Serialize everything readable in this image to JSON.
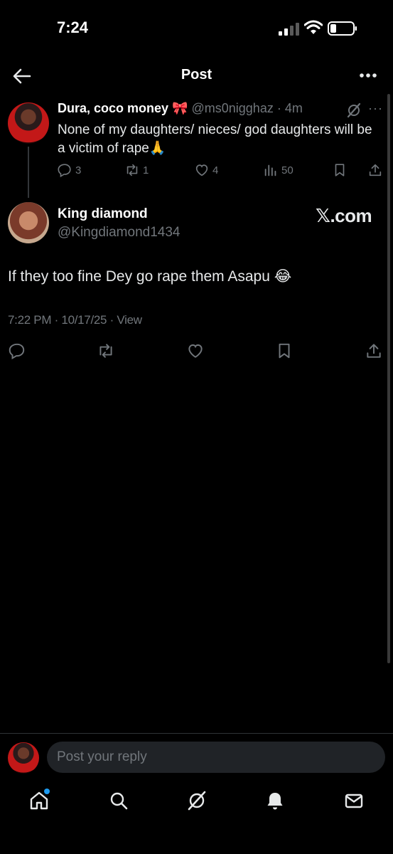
{
  "status": {
    "time": "7:24"
  },
  "nav": {
    "title": "Post"
  },
  "parent": {
    "name": "Dura, coco money",
    "emoji": "🎀",
    "handle_time": "@ms0nigghaz · 4m",
    "more": "···",
    "text": "None of my daughters/ nieces/ god daughters will be a victim of rape🙏",
    "replies": "3",
    "reposts": "1",
    "likes": "4",
    "views": "50"
  },
  "main": {
    "name": "King diamond",
    "handle": "@Kingdiamond1434",
    "watermark": "𝕏.com",
    "text": "If they too fine Dey go rape them Asapu 😂",
    "meta": "7:22 PM · 10/17/25 · View"
  },
  "reply": {
    "placeholder": "Post your reply"
  },
  "icons": {
    "back": "arrow-left-icon",
    "more": "more-icon",
    "grok": "grok-icon",
    "reply": "comment-icon",
    "repost": "repost-icon",
    "like": "heart-icon",
    "views": "views-icon",
    "bookmark": "bookmark-icon",
    "share": "share-icon",
    "home": "home-icon",
    "search": "search-icon",
    "notifications": "bell-icon",
    "messages": "mail-icon"
  },
  "colors": {
    "background": "#000000",
    "text": "#e7e9ea",
    "muted": "#71767b",
    "accent": "#1d9bf0"
  }
}
